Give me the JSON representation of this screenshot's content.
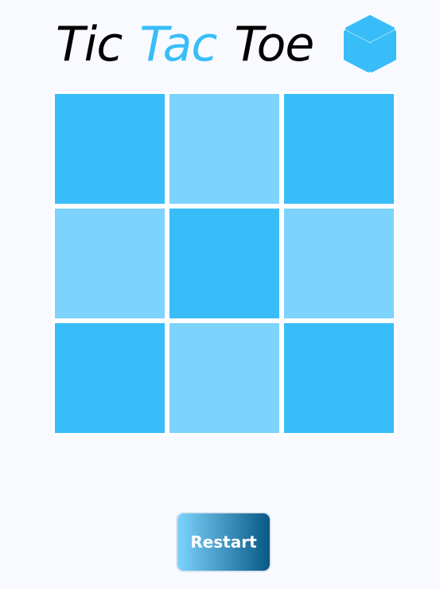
{
  "title": {
    "word1": "Tic",
    "word2": "Tac",
    "word3": "Toe",
    "icon": "cube-icon"
  },
  "colors": {
    "accent": "#38bdf8",
    "dark_cell": "#38bdf8",
    "light_cell": "#7dd3fc",
    "title_text": "#000000",
    "background": "#f8faff",
    "button_gradient_start": "#7dd3fc",
    "button_gradient_end": "#075985"
  },
  "board": {
    "cells": [
      {
        "shade": "dark"
      },
      {
        "shade": "light"
      },
      {
        "shade": "dark"
      },
      {
        "shade": "light"
      },
      {
        "shade": "dark"
      },
      {
        "shade": "light"
      },
      {
        "shade": "dark"
      },
      {
        "shade": "light"
      },
      {
        "shade": "dark"
      }
    ]
  },
  "restart_label": "Restart"
}
